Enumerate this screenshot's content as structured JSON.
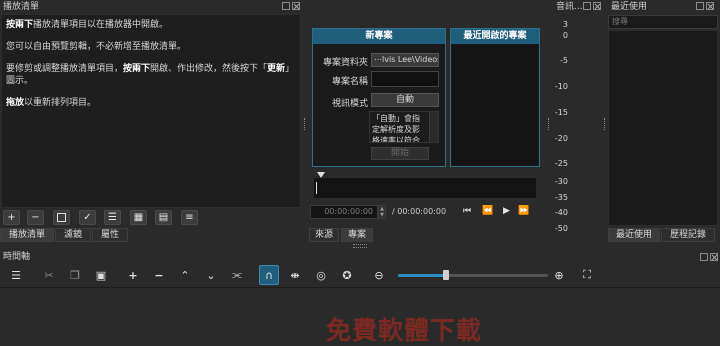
{
  "playlist": {
    "title": "播放清單",
    "help_line1_bold": "按兩下",
    "help_line1_rest": "播放清單項目以在播放器中開啟。",
    "help_line2": "您可以自由預覽剪輯，不必新增至播放清單。",
    "help_line3_a": "要修剪或調整播放清單項目，",
    "help_line3_bold1": "按兩下",
    "help_line3_b": "開啟、作出修改，然後按下「",
    "help_line3_bold2": "更新",
    "help_line3_c": "」",
    "help_line3_d": "圖示。",
    "help_line4_bold": "拖放",
    "help_line4_rest": "以重新排列項目。",
    "tabs": [
      "播放清單",
      "濾鏡",
      "屬性"
    ]
  },
  "new_project": {
    "header": "新專案",
    "folder_label": "專案資料夾",
    "folder_value": "⋯lvis Lee\\Videos",
    "name_label": "專案名稱",
    "name_value": "",
    "mode_label": "視訊模式",
    "mode_value": "自動",
    "desc": "「自動」會指定解析度及影格速率以符合新增的",
    "start_button": "開始"
  },
  "recent_projects": {
    "header": "最近開啟的專案"
  },
  "player": {
    "position": "00:00:00:00",
    "duration": "/ 00:00:00:00",
    "tabs": [
      "來源",
      "專案"
    ]
  },
  "audio": {
    "title": "音訊...",
    "scale": [
      "3",
      "0",
      "-5",
      "-10",
      "-15",
      "-20",
      "-25",
      "-30",
      "-35",
      "-40",
      "-50"
    ]
  },
  "recent": {
    "title": "最近使用",
    "search_placeholder": "搜尋",
    "tabs": [
      "最近使用",
      "歷程記錄"
    ]
  },
  "timeline": {
    "title": "時間軸"
  },
  "watermark": "免費軟體下載"
}
